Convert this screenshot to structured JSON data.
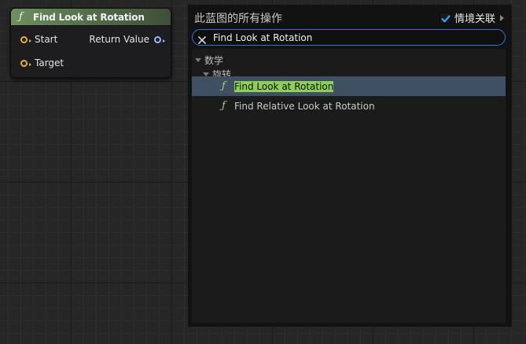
{
  "node": {
    "icon": "function-icon",
    "title": "Find Look at Rotation",
    "pins": {
      "start": "Start",
      "target": "Target",
      "return_value": "Return Value"
    }
  },
  "menu": {
    "title": "此蓝图的所有操作",
    "context_sensitive": {
      "label": "情境关联",
      "checked": true
    },
    "search": {
      "value": "Find Look at Rotation"
    },
    "tree": {
      "category": "数学",
      "subcategory": "旋转",
      "items": [
        {
          "icon": "function-icon",
          "highlight": "Find Look at Rotation",
          "rest": "",
          "selected": true
        },
        {
          "icon": "function-icon",
          "highlight": "",
          "rest": "Find Relative Look at Rotation",
          "selected": false
        }
      ]
    }
  },
  "colors": {
    "node_header": "#56704b",
    "pin_yellow": "#e8b01e",
    "pin_blue": "#9ab5ff",
    "selection": "#3e5062",
    "search_highlight": "#8fcf55",
    "search_border": "#2f77d0"
  }
}
